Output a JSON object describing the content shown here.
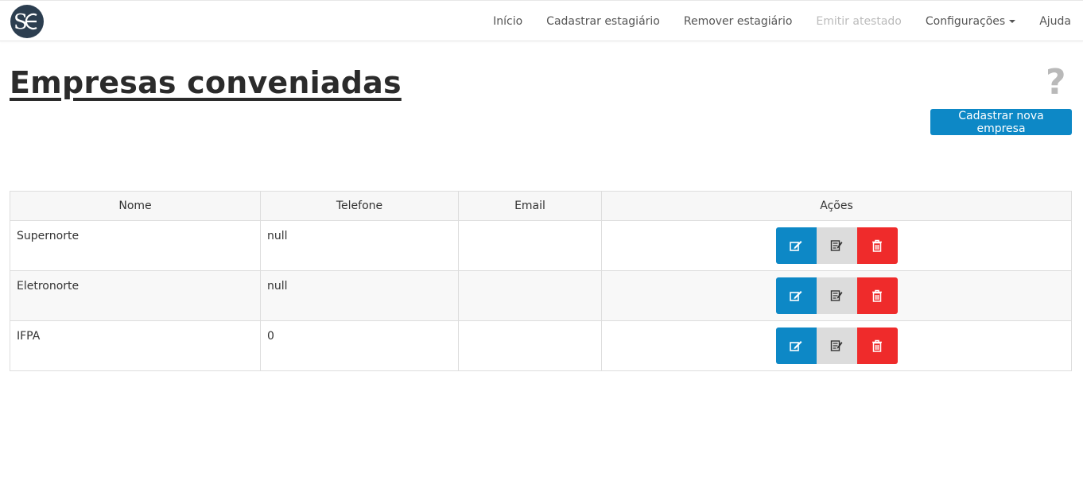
{
  "app": {
    "logo_text": "SE"
  },
  "nav": {
    "items": [
      {
        "label": "Início"
      },
      {
        "label": "Cadastrar estagiário"
      },
      {
        "label": "Remover estagiário"
      },
      {
        "label": "Emitir atestado"
      },
      {
        "label": "Configurações"
      },
      {
        "label": "Ajuda"
      }
    ]
  },
  "page": {
    "title": "Empresas conveniadas",
    "help_symbol": "?",
    "new_button_label": "Cadastrar nova empresa"
  },
  "table": {
    "headers": [
      "Nome",
      "Telefone",
      "Email",
      "Ações"
    ],
    "rows": [
      {
        "nome": "Supernorte",
        "telefone": "null",
        "email": ""
      },
      {
        "nome": "Eletronorte",
        "telefone": "null",
        "email": ""
      },
      {
        "nome": "IFPA",
        "telefone": "0",
        "email": ""
      }
    ]
  },
  "colors": {
    "primary": "#0d88c6",
    "danger": "#ef2b2b",
    "neutral": "#dcdcdc",
    "logo_bg": "#2c3e50"
  },
  "icons": {
    "edit": "edit-icon",
    "details": "details-icon",
    "delete": "trash-icon"
  }
}
